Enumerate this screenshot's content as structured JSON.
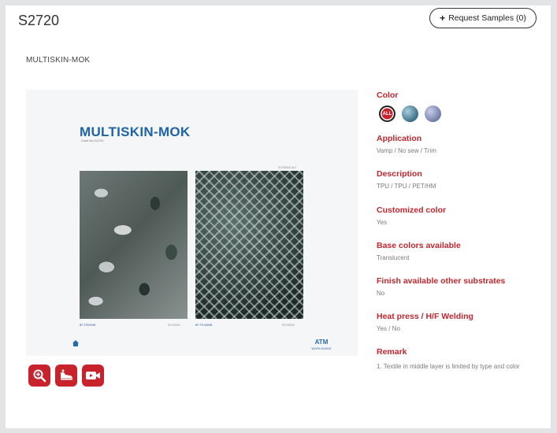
{
  "header": {
    "product_id": "S2720",
    "request_button_label": "Request Samples (0)"
  },
  "product": {
    "name": "MULTISKIN-MOK"
  },
  "catalog_image": {
    "title": "MULTISKIN-MOK",
    "subtitle": "Code No.S2720",
    "swatch_1_code": "BF-FS0099B",
    "swatch_1_ref": "S2720001",
    "swatch_2_code": "BF-FS-0089B",
    "swatch_2_ref": "S2720002",
    "corner_note": "S2720002-ALT",
    "brand": "ATM\nWORLDWIDE"
  },
  "details": {
    "color_label": "Color",
    "color_all": "ALL",
    "application_label": "Application",
    "application_value": "Vamp / No sew / Trim",
    "description_label": "Description",
    "description_value": "TPU / TPU / PET/HM",
    "customized_label": "Customized color",
    "customized_value": "Yes",
    "base_label": "Base colors available",
    "base_value": "Translucent",
    "finish_label": "Finish available other substrates",
    "finish_value": "No",
    "heat_label": "Heat press / H/F Welding",
    "heat_value": "Yes / No",
    "remark_label": "Remark",
    "remark_value": "1. Textile in middle layer is limited by type and color"
  },
  "colors": {
    "accent": "#c0262d",
    "swatch_1": "#4f8aa6",
    "swatch_2": "#8e9ac6"
  },
  "actions": [
    "zoom-icon",
    "3d-shoe-icon",
    "video-icon"
  ]
}
